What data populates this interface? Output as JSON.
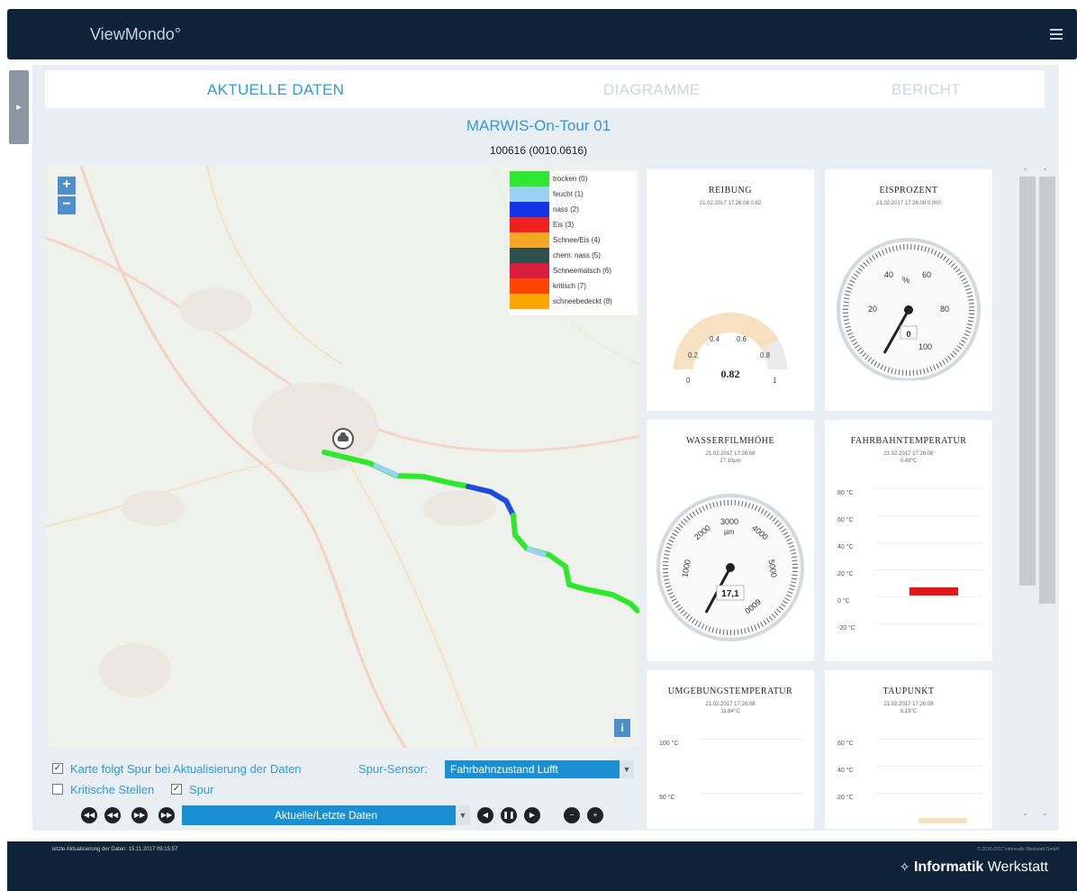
{
  "app": {
    "brand": "ViewMondo°"
  },
  "tabs": [
    {
      "label": "AKTUELLE DATEN",
      "active": true
    },
    {
      "label": "DIAGRAMME",
      "active": false
    },
    {
      "label": "BERICHT",
      "active": false
    }
  ],
  "header": {
    "title": "MARWIS-On-Tour 01",
    "subtitle": "100616 (0010.0616)"
  },
  "map": {
    "zoom_in": "+",
    "zoom_out": "−",
    "info": "i",
    "legend": [
      {
        "label": "trocken (0)",
        "color": "#2ee82e"
      },
      {
        "label": "feucht (1)",
        "color": "#9ad0f0"
      },
      {
        "label": "nass (2)",
        "color": "#1432e6"
      },
      {
        "label": "Eis (3)",
        "color": "#ee2020"
      },
      {
        "label": "Schnee/Eis (4)",
        "color": "#f5a623"
      },
      {
        "label": "chem. nass (5)",
        "color": "#2f4f4f"
      },
      {
        "label": "Schneematsch (6)",
        "color": "#d81e3c"
      },
      {
        "label": "kritisch (7)",
        "color": "#ff4500"
      },
      {
        "label": "schneebedeckt (8)",
        "color": "#ffa500"
      }
    ]
  },
  "controls": {
    "follow_label": "Karte folgt Spur bei Aktualisierung der Daten",
    "follow_checked": true,
    "sensor_label": "Spur-Sensor:",
    "sensor_value": "Fahrbahnzustand Lufft",
    "critical_label": "Kritische Stellen",
    "critical_checked": false,
    "track_label": "Spur",
    "track_checked": true,
    "mode_value": "Aktuelle/Letzte Daten"
  },
  "cards": {
    "reibung": {
      "title": "REIBUNG",
      "timestamp": "21.02.2017 17:26:08 0.82",
      "value": "0.82",
      "ticks": [
        "0",
        "0.2",
        "0.4",
        "0.6",
        "0.8",
        "1"
      ],
      "level": 0.82
    },
    "eisprozent": {
      "title": "EISPROZENT",
      "timestamp": "21.02.2017 17:26:08 0.000",
      "value": "0",
      "unit": "%",
      "ticks": [
        "20",
        "40",
        "60",
        "80",
        "100"
      ]
    },
    "wasserfilm": {
      "title": "WASSERFILMHÖHE",
      "timestamp": "21.02.2017 17:26:08",
      "value_line": "17.10µm",
      "value": "17,1",
      "unit": "µm",
      "ticks": [
        "1000",
        "2000",
        "3000",
        "4000",
        "5000",
        "6000"
      ]
    },
    "fahrbahntemp": {
      "title": "FAHRBAHNTEMPERATUR",
      "timestamp": "21.02.2017 17:26:08",
      "value_line": "0.49°C",
      "axis": [
        "80 °C",
        "60 °C",
        "40 °C",
        "20 °C",
        "0 °C",
        "-20 °C"
      ],
      "bar_color": "#e01818"
    },
    "umgebungstemp": {
      "title": "UMGEBUNGSTEMPERATUR",
      "timestamp": "21.02.2017 17:26:08",
      "value_line": "11.84°C",
      "axis": [
        "100 °C",
        "50 °C"
      ]
    },
    "taupunkt": {
      "title": "TAUPUNKT",
      "timestamp": "21.02.2017 17:26:08",
      "value_line": "8.19°C",
      "axis": [
        "60 °C",
        "40 °C",
        "20 °C"
      ]
    }
  },
  "footer": {
    "last_update": "letzte Aktualisierung der Daten: 15.11.2017 09:15:57",
    "copyright": "© 2016-2017 Informatik Werkstatt GmbH",
    "logo_bold": "Informatik",
    "logo_rest": " Werkstatt"
  }
}
